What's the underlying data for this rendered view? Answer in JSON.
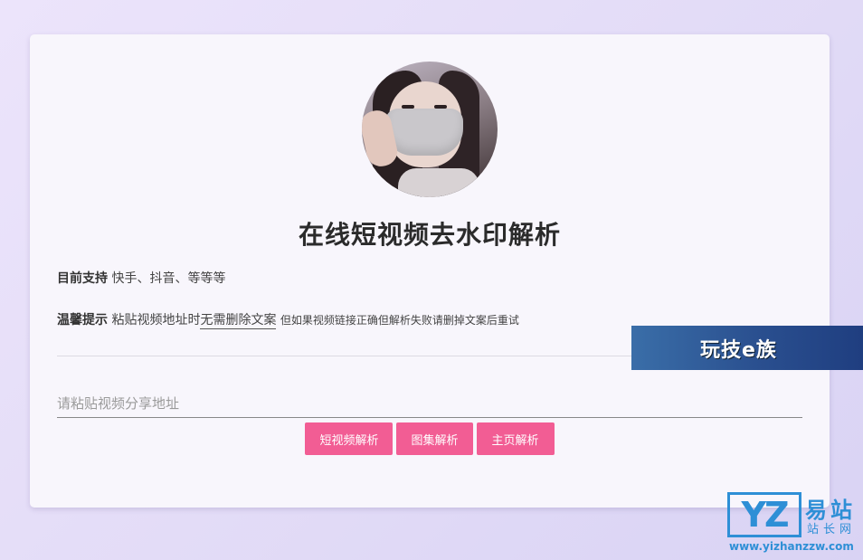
{
  "page": {
    "title": "在线短视频去水印解析"
  },
  "support": {
    "label": "目前支持",
    "text": "快手、抖音、等等等"
  },
  "tip": {
    "label": "温馨提示",
    "text_before": "粘贴视频地址时",
    "emphasis": "无需删除文案",
    "note": "但如果视频链接正确但解析失败请删掉文案后重试"
  },
  "input": {
    "placeholder": "请粘贴视频分享地址",
    "value": ""
  },
  "buttons": {
    "video": "短视频解析",
    "gallery": "图集解析",
    "homepage": "主页解析"
  },
  "overlays": {
    "banner_text": "玩技e族",
    "watermark_logo": "YZ",
    "watermark_name": "易站",
    "watermark_sub": "站长网",
    "watermark_url": "www.yizhanzzw.com"
  },
  "colors": {
    "accent": "#f25d94",
    "background": "#e6dff8",
    "card": "#f8f6fc",
    "banner": "#2a4f8f",
    "watermark": "#2e8fd6"
  }
}
